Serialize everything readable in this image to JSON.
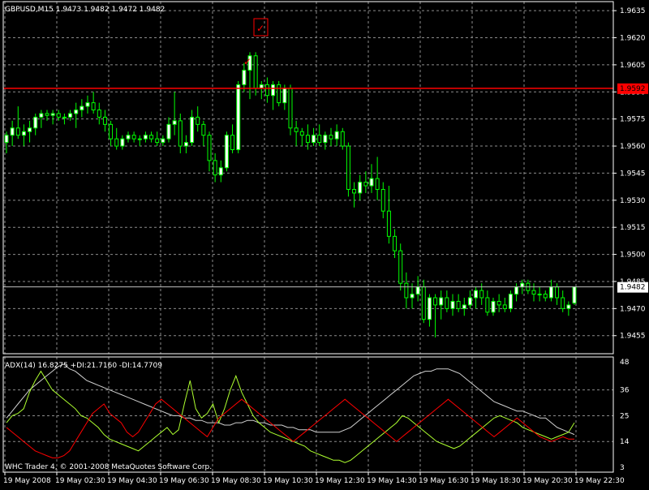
{
  "header": {
    "symbol_line": "GBPUSD,M15  1.9473  1.9482  1.9472  1.9482"
  },
  "indicator": {
    "label": "ADX(14) 16.8275  +DI:21.7160  -DI:14.7709"
  },
  "copyright": "WHC Trader 4, © 2001-2008 MetaQuotes Software Corp.",
  "colors": {
    "background": "#000000",
    "grid": "#8c8c8c",
    "bull_candle": "#ffffff",
    "bear_candle": "#000000",
    "candle_border": "#00ff00",
    "level_line": "#ff0000",
    "current_price_line": "#c0c0c0",
    "adx_line": "#d0d0d0",
    "plus_di_line": "#adff2f",
    "minus_di_line": "#ff0000",
    "axis_text": "#ffffff",
    "arrow": "#ff0000"
  },
  "annotations": {
    "horizontal_level_label": "1.9592",
    "current_price_label": "1.9482",
    "check_marker": "✓"
  },
  "chart_data": [
    {
      "type": "candlestick",
      "title": "GBPUSD,M15",
      "ylim": [
        1.9445,
        1.964
      ],
      "y_ticks": [
        "1.9635",
        "1.9620",
        "1.9605",
        "1.9590",
        "1.9575",
        "1.9560",
        "1.9545",
        "1.9530",
        "1.9515",
        "1.9500",
        "1.9485",
        "1.9470",
        "1.9455"
      ],
      "x_ticks": [
        "19 May 2008",
        "19 May 02:30",
        "19 May 04:30",
        "19 May 06:30",
        "19 May 08:30",
        "19 May 10:30",
        "19 May 12:30",
        "19 May 14:30",
        "19 May 16:30",
        "19 May 18:30",
        "19 May 20:30",
        "19 May 22:30"
      ],
      "horizontal_level": 1.9592,
      "current_price": 1.9482,
      "ohlc": [
        [
          1.9562,
          1.9568,
          1.9556,
          1.9566
        ],
        [
          1.9566,
          1.9574,
          1.956,
          1.957
        ],
        [
          1.957,
          1.9582,
          1.9564,
          1.9566
        ],
        [
          1.9566,
          1.9572,
          1.956,
          1.9568
        ],
        [
          1.9568,
          1.9574,
          1.9562,
          1.957
        ],
        [
          1.957,
          1.9578,
          1.9566,
          1.9576
        ],
        [
          1.9576,
          1.958,
          1.957,
          1.9578
        ],
        [
          1.9578,
          1.958,
          1.9574,
          1.9577
        ],
        [
          1.9577,
          1.958,
          1.9572,
          1.9578
        ],
        [
          1.9578,
          1.958,
          1.9574,
          1.9576
        ],
        [
          1.9576,
          1.9578,
          1.9572,
          1.9576
        ],
        [
          1.9576,
          1.958,
          1.9574,
          1.9578
        ],
        [
          1.9578,
          1.9584,
          1.957,
          1.958
        ],
        [
          1.958,
          1.9586,
          1.9576,
          1.9582
        ],
        [
          1.9582,
          1.9588,
          1.9578,
          1.9584
        ],
        [
          1.9584,
          1.959,
          1.9578,
          1.958
        ],
        [
          1.958,
          1.9584,
          1.9572,
          1.9576
        ],
        [
          1.9576,
          1.958,
          1.9568,
          1.9572
        ],
        [
          1.9572,
          1.9574,
          1.956,
          1.9564
        ],
        [
          1.9564,
          1.957,
          1.9558,
          1.956
        ],
        [
          1.956,
          1.9566,
          1.9558,
          1.9564
        ],
        [
          1.9564,
          1.9568,
          1.9562,
          1.9566
        ],
        [
          1.9566,
          1.9568,
          1.9562,
          1.9564
        ],
        [
          1.9564,
          1.9566,
          1.956,
          1.9564
        ],
        [
          1.9564,
          1.9568,
          1.9562,
          1.9566
        ],
        [
          1.9566,
          1.9568,
          1.9562,
          1.9564
        ],
        [
          1.9564,
          1.9568,
          1.956,
          1.9562
        ],
        [
          1.9562,
          1.9566,
          1.956,
          1.9564
        ],
        [
          1.9564,
          1.9576,
          1.9562,
          1.9572
        ],
        [
          1.9572,
          1.959,
          1.9566,
          1.9574
        ],
        [
          1.9574,
          1.9578,
          1.9556,
          1.956
        ],
        [
          1.956,
          1.9566,
          1.9556,
          1.9562
        ],
        [
          1.9562,
          1.958,
          1.956,
          1.9576
        ],
        [
          1.9576,
          1.9582,
          1.9568,
          1.9572
        ],
        [
          1.9572,
          1.9574,
          1.956,
          1.9566
        ],
        [
          1.9566,
          1.9568,
          1.9546,
          1.9552
        ],
        [
          1.9552,
          1.9556,
          1.954,
          1.9544
        ],
        [
          1.9544,
          1.9552,
          1.954,
          1.9548
        ],
        [
          1.9548,
          1.9568,
          1.9546,
          1.9566
        ],
        [
          1.9566,
          1.9572,
          1.9556,
          1.9558
        ],
        [
          1.9558,
          1.9596,
          1.9556,
          1.9594
        ],
        [
          1.9594,
          1.9606,
          1.959,
          1.9602
        ],
        [
          1.9602,
          1.9612,
          1.9586,
          1.961
        ],
        [
          1.961,
          1.9612,
          1.9588,
          1.9592
        ],
        [
          1.9592,
          1.9596,
          1.9586,
          1.9594
        ],
        [
          1.9594,
          1.9598,
          1.9584,
          1.9588
        ],
        [
          1.9588,
          1.9596,
          1.958,
          1.9594
        ],
        [
          1.9594,
          1.9596,
          1.9582,
          1.9584
        ],
        [
          1.9584,
          1.9594,
          1.958,
          1.9592
        ],
        [
          1.9592,
          1.9594,
          1.9566,
          1.957
        ],
        [
          1.957,
          1.9574,
          1.956,
          1.9568
        ],
        [
          1.9568,
          1.957,
          1.956,
          1.9566
        ],
        [
          1.9566,
          1.9572,
          1.9558,
          1.9562
        ],
        [
          1.9562,
          1.957,
          1.956,
          1.9566
        ],
        [
          1.9566,
          1.9572,
          1.956,
          1.9562
        ],
        [
          1.9562,
          1.9568,
          1.9558,
          1.9566
        ],
        [
          1.9566,
          1.957,
          1.956,
          1.9564
        ],
        [
          1.9564,
          1.9572,
          1.956,
          1.9568
        ],
        [
          1.9568,
          1.957,
          1.9558,
          1.956
        ],
        [
          1.956,
          1.9562,
          1.9532,
          1.9536
        ],
        [
          1.9536,
          1.954,
          1.9526,
          1.9534
        ],
        [
          1.9534,
          1.9544,
          1.953,
          1.954
        ],
        [
          1.954,
          1.9546,
          1.9534,
          1.9538
        ],
        [
          1.9538,
          1.955,
          1.9534,
          1.9542
        ],
        [
          1.9542,
          1.9554,
          1.953,
          1.9536
        ],
        [
          1.9536,
          1.954,
          1.952,
          1.9524
        ],
        [
          1.9524,
          1.9538,
          1.9506,
          1.951
        ],
        [
          1.951,
          1.9514,
          1.9498,
          1.9502
        ],
        [
          1.9502,
          1.9506,
          1.948,
          1.9484
        ],
        [
          1.9484,
          1.949,
          1.947,
          1.9476
        ],
        [
          1.9476,
          1.9484,
          1.947,
          1.9478
        ],
        [
          1.9478,
          1.9488,
          1.9474,
          1.9482
        ],
        [
          1.9482,
          1.9486,
          1.9462,
          1.9464
        ],
        [
          1.9464,
          1.9478,
          1.946,
          1.9476
        ],
        [
          1.9476,
          1.9478,
          1.9454,
          1.9472
        ],
        [
          1.9472,
          1.948,
          1.9464,
          1.9476
        ],
        [
          1.9476,
          1.948,
          1.9468,
          1.947
        ],
        [
          1.947,
          1.9478,
          1.9466,
          1.9474
        ],
        [
          1.9474,
          1.9478,
          1.9468,
          1.947
        ],
        [
          1.947,
          1.9476,
          1.9466,
          1.9472
        ],
        [
          1.9472,
          1.948,
          1.947,
          1.9476
        ],
        [
          1.9476,
          1.9482,
          1.947,
          1.948
        ],
        [
          1.948,
          1.9484,
          1.9472,
          1.9476
        ],
        [
          1.9476,
          1.948,
          1.9466,
          1.9468
        ],
        [
          1.9468,
          1.9476,
          1.9466,
          1.9474
        ],
        [
          1.9474,
          1.9478,
          1.9468,
          1.9472
        ],
        [
          1.9472,
          1.9476,
          1.9468,
          1.947
        ],
        [
          1.947,
          1.948,
          1.9468,
          1.9478
        ],
        [
          1.9478,
          1.9484,
          1.9474,
          1.9482
        ],
        [
          1.9482,
          1.9486,
          1.9478,
          1.9484
        ],
        [
          1.9484,
          1.9486,
          1.9478,
          1.948
        ],
        [
          1.948,
          1.9484,
          1.9474,
          1.9478
        ],
        [
          1.9478,
          1.9482,
          1.9474,
          1.9478
        ],
        [
          1.9478,
          1.948,
          1.9474,
          1.9476
        ],
        [
          1.9476,
          1.9486,
          1.9474,
          1.9482
        ],
        [
          1.9482,
          1.9484,
          1.9472,
          1.9476
        ],
        [
          1.9476,
          1.948,
          1.9468,
          1.947
        ],
        [
          1.947,
          1.9474,
          1.9466,
          1.9472
        ],
        [
          1.9473,
          1.9482,
          1.9472,
          1.9482
        ]
      ]
    },
    {
      "type": "line",
      "title": "ADX(14)",
      "ylim": [
        3,
        48
      ],
      "y_ticks": [
        "48",
        "36",
        "25",
        "14",
        "3"
      ],
      "series": [
        {
          "name": "ADX",
          "values": [
            24,
            27,
            30,
            33,
            36,
            38,
            40,
            42,
            44,
            46,
            47,
            45,
            44,
            42,
            40,
            39,
            38,
            37,
            36,
            35,
            34,
            33,
            32,
            31,
            30,
            29,
            28,
            27,
            26,
            25,
            25,
            24,
            24,
            23,
            23,
            22,
            22,
            22,
            21,
            21,
            22,
            22,
            23,
            23,
            22,
            22,
            21,
            21,
            21,
            20,
            20,
            19,
            19,
            19,
            18,
            18,
            18,
            18,
            18,
            19,
            20,
            22,
            24,
            26,
            28,
            30,
            32,
            34,
            36,
            38,
            40,
            42,
            43,
            44,
            44,
            45,
            45,
            45,
            44,
            43,
            41,
            39,
            37,
            35,
            33,
            31,
            30,
            29,
            28,
            27,
            27,
            26,
            25,
            24,
            24,
            22,
            20,
            19,
            18,
            17
          ]
        },
        {
          "name": "+DI",
          "values": [
            22,
            25,
            26,
            28,
            35,
            40,
            44,
            40,
            36,
            34,
            32,
            30,
            28,
            25,
            24,
            22,
            20,
            17,
            15,
            14,
            13,
            12,
            11,
            10,
            12,
            14,
            16,
            18,
            20,
            17,
            19,
            30,
            40,
            28,
            24,
            26,
            30,
            22,
            28,
            36,
            42,
            35,
            30,
            25,
            22,
            20,
            18,
            17,
            16,
            15,
            14,
            13,
            12,
            10,
            9,
            8,
            7,
            6,
            6,
            5,
            6,
            8,
            10,
            12,
            14,
            16,
            18,
            20,
            22,
            25,
            24,
            22,
            20,
            18,
            16,
            14,
            13,
            12,
            11,
            12,
            14,
            16,
            18,
            20,
            22,
            24,
            25,
            24,
            23,
            22,
            20,
            19,
            18,
            17,
            16,
            15,
            16,
            17,
            18,
            22
          ]
        },
        {
          "name": "-DI",
          "values": [
            20,
            18,
            16,
            14,
            12,
            10,
            9,
            8,
            7,
            7,
            8,
            10,
            14,
            18,
            22,
            26,
            28,
            30,
            26,
            24,
            22,
            18,
            16,
            18,
            22,
            26,
            30,
            32,
            30,
            28,
            26,
            24,
            22,
            20,
            18,
            16,
            20,
            24,
            26,
            28,
            30,
            32,
            30,
            28,
            26,
            24,
            22,
            20,
            18,
            16,
            14,
            16,
            18,
            20,
            22,
            24,
            26,
            28,
            30,
            32,
            30,
            28,
            26,
            24,
            22,
            20,
            18,
            16,
            14,
            16,
            18,
            20,
            22,
            24,
            26,
            28,
            30,
            32,
            30,
            28,
            26,
            24,
            22,
            20,
            18,
            16,
            18,
            20,
            22,
            24,
            22,
            20,
            18,
            16,
            15,
            14,
            15,
            16,
            15,
            15
          ]
        }
      ]
    }
  ]
}
